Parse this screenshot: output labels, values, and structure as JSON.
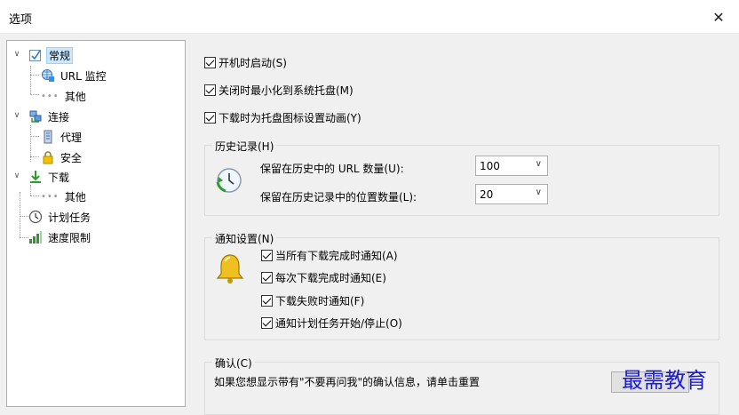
{
  "window": {
    "title": "选项",
    "close_glyph": "✕"
  },
  "tree": {
    "general": "常规",
    "url_monitor": "URL 监控",
    "other1": "其他",
    "connection": "连接",
    "proxy": "代理",
    "security": "安全",
    "download": "下载",
    "other2": "其他",
    "schedule": "计划任务",
    "speed_limit": "速度限制"
  },
  "options": {
    "start_on_boot": "开机时启动(S)",
    "minimize_to_tray": "关闭时最小化到系统托盘(M)",
    "animate_tray": "下载时为托盘图标设置动画(Y)"
  },
  "history": {
    "title": "历史记录(H)",
    "url_count_label": "保留在历史中的 URL 数量(U):",
    "url_count_value": "100",
    "position_count_label": "保留在历史记录中的位置数量(L):",
    "position_count_value": "20"
  },
  "notify": {
    "title": "通知设置(N)",
    "all_done": "当所有下载完成时通知(A)",
    "each_done": "每次下载完成时通知(E)",
    "failed": "下载失败时通知(F)",
    "schedule": "通知计划任务开始/停止(O)"
  },
  "confirm": {
    "title": "确认(C)",
    "text": "如果您想显示带有\"不要再问我\"的确认信息，请单击重置"
  },
  "watermark": "最需教育",
  "colors": {
    "selection": "#cce8ff",
    "green_arrow": "#2e9a2e",
    "lock": "#e6b400"
  }
}
